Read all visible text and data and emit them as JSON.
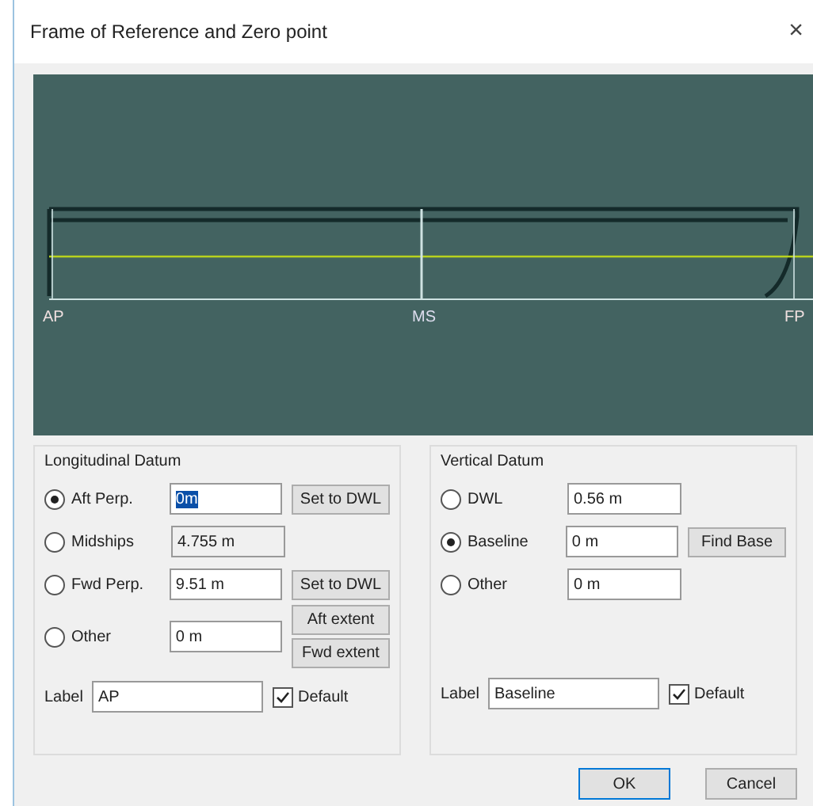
{
  "window": {
    "title": "Frame of Reference and Zero point",
    "close": "×"
  },
  "view": {
    "stations": [
      {
        "label": "AP",
        "kind": "end"
      },
      {
        "label": "MS",
        "kind": "mid"
      },
      {
        "label": "FP",
        "kind": "end"
      }
    ]
  },
  "longitudinal": {
    "title": "Longitudinal Datum",
    "rows": [
      {
        "label": "Aft Perp.",
        "value": "0m",
        "selected": true,
        "disabled": false,
        "highlighted": true,
        "buttons": [
          "Set to DWL"
        ]
      },
      {
        "label": "Midships",
        "value": "4.755 m",
        "selected": false,
        "disabled": true,
        "highlighted": false,
        "buttons": []
      },
      {
        "label": "Fwd Perp.",
        "value": "9.51 m",
        "selected": false,
        "disabled": false,
        "highlighted": false,
        "buttons": [
          "Set to DWL"
        ]
      },
      {
        "label": "Other",
        "value": "0 m",
        "selected": false,
        "disabled": false,
        "highlighted": false,
        "buttons": [
          "Aft extent",
          "Fwd extent"
        ]
      }
    ],
    "label": {
      "caption": "Label",
      "value": "AP"
    },
    "default": {
      "label": "Default",
      "checked": true
    }
  },
  "vertical": {
    "title": "Vertical Datum",
    "rows": [
      {
        "label": "DWL",
        "value": "0.56 m",
        "selected": false,
        "disabled": false,
        "highlighted": false,
        "buttons": []
      },
      {
        "label": "Baseline",
        "value": "0 m",
        "selected": true,
        "disabled": false,
        "highlighted": false,
        "buttons": [
          "Find Base"
        ]
      },
      {
        "label": "Other",
        "value": "0 m",
        "selected": false,
        "disabled": false,
        "highlighted": false,
        "buttons": []
      }
    ],
    "label": {
      "caption": "Label",
      "value": "Baseline"
    },
    "default": {
      "label": "Default",
      "checked": true
    }
  },
  "buttons": [
    {
      "label": "OK",
      "primary": true
    },
    {
      "label": "Cancel",
      "primary": false
    }
  ]
}
